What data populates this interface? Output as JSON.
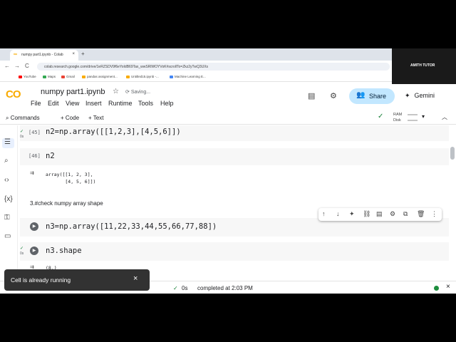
{
  "browser": {
    "tab_title": "numpy part1.ipynb - Colab",
    "tab_close": "×",
    "new_tab": "+",
    "nav": {
      "back": "←",
      "forward": "→",
      "reload": "C"
    },
    "url": "colab.research.google.com/drive/1eRZSDV9f6eYoIdB69Tax_wwSRlWOYVoK#scrollTo=Zkz2yTwQ3UXs",
    "bookmarks": [
      {
        "label": "YouTube",
        "color": "#ff0000"
      },
      {
        "label": "Maps",
        "color": "#34a853"
      },
      {
        "label": "Gmail",
        "color": "#ea4335"
      },
      {
        "label": "pandas assignment...",
        "color": "#f9ab00"
      },
      {
        "label": "Untitled15.ipynb -...",
        "color": "#f9ab00"
      },
      {
        "label": "Machine Learning E...",
        "color": "#4285f4"
      }
    ]
  },
  "user": {
    "name": "AMITH TUTOR"
  },
  "colab": {
    "logo": "CO",
    "notebook_title": "numpy part1.ipynb",
    "star_icon": "☆",
    "saving_status": "Saving...",
    "menu": [
      "File",
      "Edit",
      "View",
      "Insert",
      "Runtime",
      "Tools",
      "Help"
    ],
    "share_label": "Share",
    "gemini_label": "Gemini",
    "toolbar": {
      "commands": "Commands",
      "code": "+ Code",
      "text": "+ Text",
      "ram": "RAM",
      "disk": "Disk"
    }
  },
  "cells": [
    {
      "type": "code",
      "exec": "[45]",
      "status": "0s",
      "source": "n2=np.array([[1,2,3],[4,5,6]])"
    },
    {
      "type": "code",
      "exec": "[46]",
      "status": "0s",
      "source": "n2",
      "output": "array([[1, 2, 3],\n       [4, 5, 6]])"
    },
    {
      "type": "text",
      "text": "3.#check numpy array shape"
    },
    {
      "type": "code",
      "exec": "",
      "status": "",
      "source": "n3=np.array([11,22,33,44,55,66,77,88])"
    },
    {
      "type": "code",
      "exec": "",
      "status": "0s",
      "source": "n3.shape",
      "output": "(8,)"
    }
  ],
  "toast": {
    "message": "Cell is already running",
    "close": "×"
  },
  "statusbar": {
    "elapsed": "0s",
    "completed": "completed at 2:03 PM"
  },
  "colors": {
    "accent": "#c2e7ff",
    "logo_orange": "#f9ab00",
    "ok_green": "#188038"
  }
}
